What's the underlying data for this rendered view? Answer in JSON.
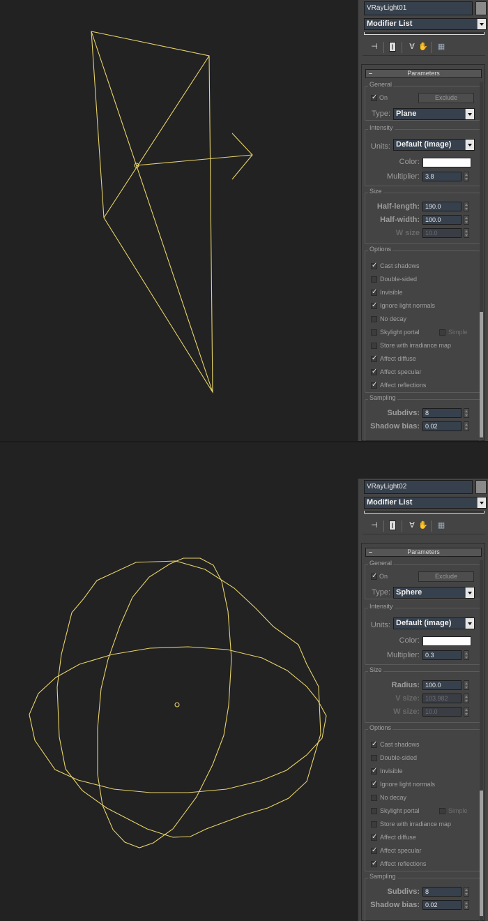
{
  "panels": [
    {
      "object_name": "VRayLight01",
      "modifier_list": "Modifier List",
      "rollout_title": "Parameters",
      "general": {
        "title": "General",
        "on_label": "On",
        "on_checked": true,
        "exclude_button": "Exclude",
        "type_label": "Type:",
        "type_value": "Plane"
      },
      "intensity": {
        "title": "Intensity",
        "units_label": "Units:",
        "units_value": "Default (image)",
        "color_label": "Color:",
        "color_value": "#ffffff",
        "multiplier_label": "Multiplier:",
        "multiplier_value": "3.8"
      },
      "size": {
        "title": "Size",
        "rows": [
          {
            "label": "Half-length:",
            "value": "190.0",
            "enabled": true
          },
          {
            "label": "Half-width:",
            "value": "100.0",
            "enabled": true
          },
          {
            "label": "W size",
            "value": "10.0",
            "enabled": false
          }
        ]
      },
      "options": {
        "title": "Options",
        "items": [
          {
            "label": "Cast shadows",
            "checked": true
          },
          {
            "label": "Double-sided",
            "checked": false
          },
          {
            "label": "Invisible",
            "checked": true
          },
          {
            "label": "Ignore light normals",
            "checked": true
          },
          {
            "label": "No decay",
            "checked": false
          },
          {
            "label": "Skylight portal",
            "checked": false
          },
          {
            "label": "Store with irradiance map",
            "checked": false
          },
          {
            "label": "Affect diffuse",
            "checked": true
          },
          {
            "label": "Affect specular",
            "checked": true
          },
          {
            "label": "Affect reflections",
            "checked": true
          }
        ],
        "simple_label": "Simple",
        "simple_checked": false
      },
      "sampling": {
        "title": "Sampling",
        "subdivs_label": "Subdivs:",
        "subdivs_value": "8",
        "shadow_bias_label": "Shadow bias:",
        "shadow_bias_value": "0.02"
      }
    },
    {
      "object_name": "VRayLight02",
      "modifier_list": "Modifier List",
      "rollout_title": "Parameters",
      "general": {
        "title": "General",
        "on_label": "On",
        "on_checked": true,
        "exclude_button": "Exclude",
        "type_label": "Type:",
        "type_value": "Sphere"
      },
      "intensity": {
        "title": "Intensity",
        "units_label": "Units:",
        "units_value": "Default (image)",
        "color_label": "Color:",
        "color_value": "#ffffff",
        "multiplier_label": "Multiplier:",
        "multiplier_value": "0.3"
      },
      "size": {
        "title": "Size",
        "rows": [
          {
            "label": "Radius:",
            "value": "100.0",
            "enabled": true
          },
          {
            "label": "V size:",
            "value": "103.982",
            "enabled": false
          },
          {
            "label": "W size:",
            "value": "10.0",
            "enabled": false
          }
        ]
      },
      "options": {
        "title": "Options",
        "items": [
          {
            "label": "Cast shadows",
            "checked": true
          },
          {
            "label": "Double-sided",
            "checked": false
          },
          {
            "label": "Invisible",
            "checked": true
          },
          {
            "label": "Ignore light normals",
            "checked": true
          },
          {
            "label": "No decay",
            "checked": false
          },
          {
            "label": "Skylight portal",
            "checked": false
          },
          {
            "label": "Store with irradiance map",
            "checked": false
          },
          {
            "label": "Affect diffuse",
            "checked": true
          },
          {
            "label": "Affect specular",
            "checked": true
          },
          {
            "label": "Affect reflections",
            "checked": true
          }
        ],
        "simple_label": "Simple",
        "simple_checked": false
      },
      "sampling": {
        "title": "Sampling",
        "subdivs_label": "Subdivs:",
        "subdivs_value": "8",
        "shadow_bias_label": "Shadow bias:",
        "shadow_bias_value": "0.02"
      }
    }
  ],
  "colors": {
    "viewport_bg": "#222222",
    "wireframe": "#e8d36a",
    "field_bg": "#37414d"
  }
}
